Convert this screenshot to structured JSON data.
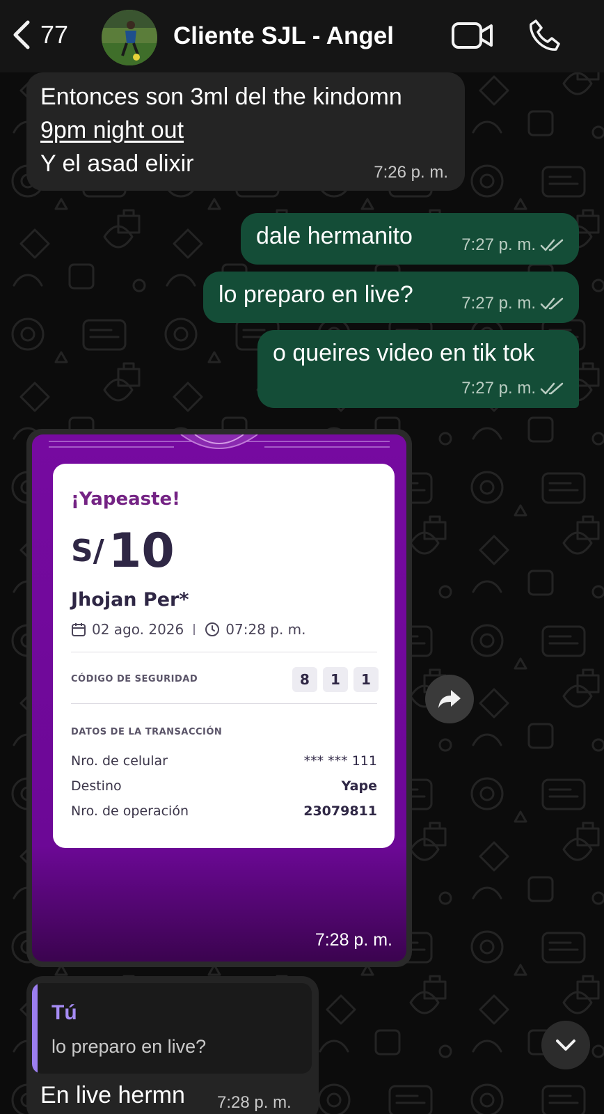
{
  "header": {
    "unread_count": "77",
    "contact_name": "Cliente SJL - Angel",
    "icons": {
      "back": "chevron-left-icon",
      "video": "video-camera-icon",
      "call": "phone-icon"
    }
  },
  "messages": [
    {
      "direction": "incoming",
      "lines": [
        "Entonces son 3ml del the kindomn",
        "9pm night out",
        "Y el asad elixir"
      ],
      "time": "7:26 p. m."
    },
    {
      "direction": "outgoing",
      "text": "dale hermanito",
      "time": "7:27 p. m."
    },
    {
      "direction": "outgoing",
      "text": "lo preparo en live?",
      "time": "7:27 p. m."
    },
    {
      "direction": "outgoing",
      "text": "o queires video en tik tok",
      "time": "7:27 p. m."
    }
  ],
  "yape_receipt": {
    "title": "¡Yapeaste!",
    "currency": "S/",
    "amount": "10",
    "recipient": "Jhojan Per*",
    "date": "02 ago. 2026",
    "time": "07:28 p. m.",
    "security_label": "CÓDIGO DE SEGURIDAD",
    "security_code": [
      "8",
      "1",
      "1"
    ],
    "transaction_label": "DATOS DE LA TRANSACCIÓN",
    "rows": [
      {
        "label": "Nro. de celular",
        "value": "*** *** 111"
      },
      {
        "label": "Destino",
        "value": "Yape"
      },
      {
        "label": "Nro. de operación",
        "value": "23079811"
      }
    ],
    "message_time": "7:28 p. m.",
    "accent_color": "#742384",
    "background_color": "#760aa0"
  },
  "reply_message": {
    "quoted_author": "Tú",
    "quoted_text": "lo preparo en live?",
    "text": "En live hermn",
    "time": "7:28 p. m."
  },
  "colors": {
    "incoming_bubble": "#242424",
    "outgoing_bubble": "#144d37",
    "header": "#151515"
  }
}
